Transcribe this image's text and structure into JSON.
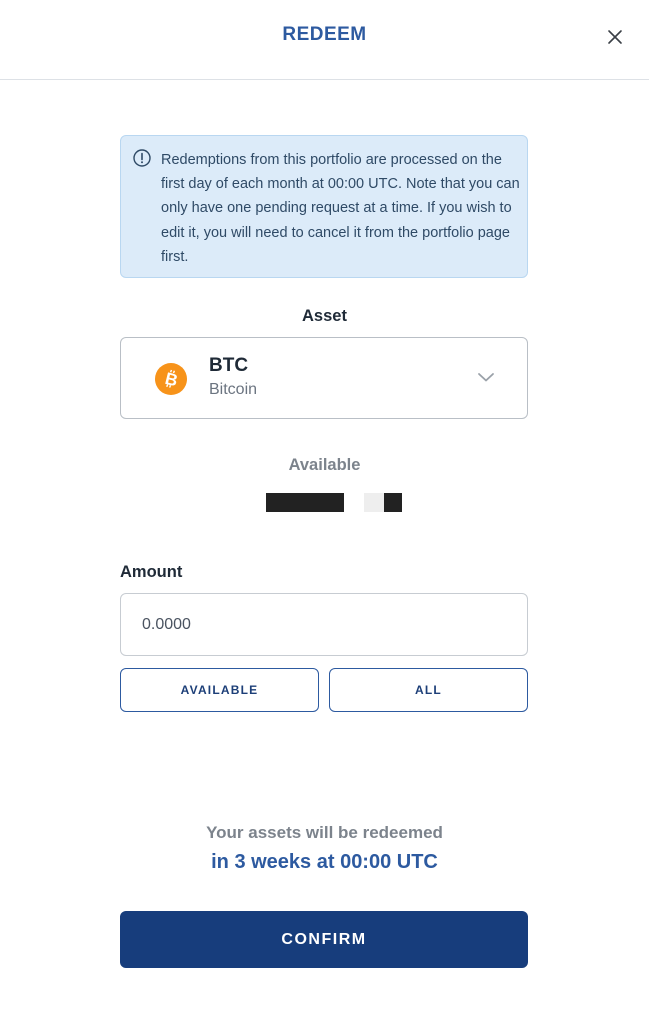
{
  "header": {
    "title": "REDEEM",
    "close_icon": "close-icon"
  },
  "notice": {
    "icon": "info-icon",
    "text": "Redemptions from this portfolio are processed on the first day of each month at 00:00 UTC. Note that you can only have one pending request at a time. If you wish to edit it, you will need to cancel it from the portfolio page first."
  },
  "asset": {
    "label": "Asset",
    "selected": {
      "code": "BTC",
      "name": "Bitcoin",
      "icon": "bitcoin-icon",
      "icon_color": "#f7931a"
    },
    "chevron_icon": "chevron-down-icon"
  },
  "available": {
    "label": "Available"
  },
  "amount": {
    "label": "Amount",
    "placeholder": "0.0000"
  },
  "quick_buttons": {
    "available_label": "AVAILABLE",
    "all_label": "ALL"
  },
  "redeem_info": {
    "note": "Your assets will be redeemed",
    "time": "in 3 weeks at 00:00 UTC"
  },
  "confirm": {
    "label": "CONFIRM"
  },
  "colors": {
    "accent": "#2d5aa0",
    "primary_button": "#173d7c",
    "notice_bg": "#dcebf9"
  }
}
